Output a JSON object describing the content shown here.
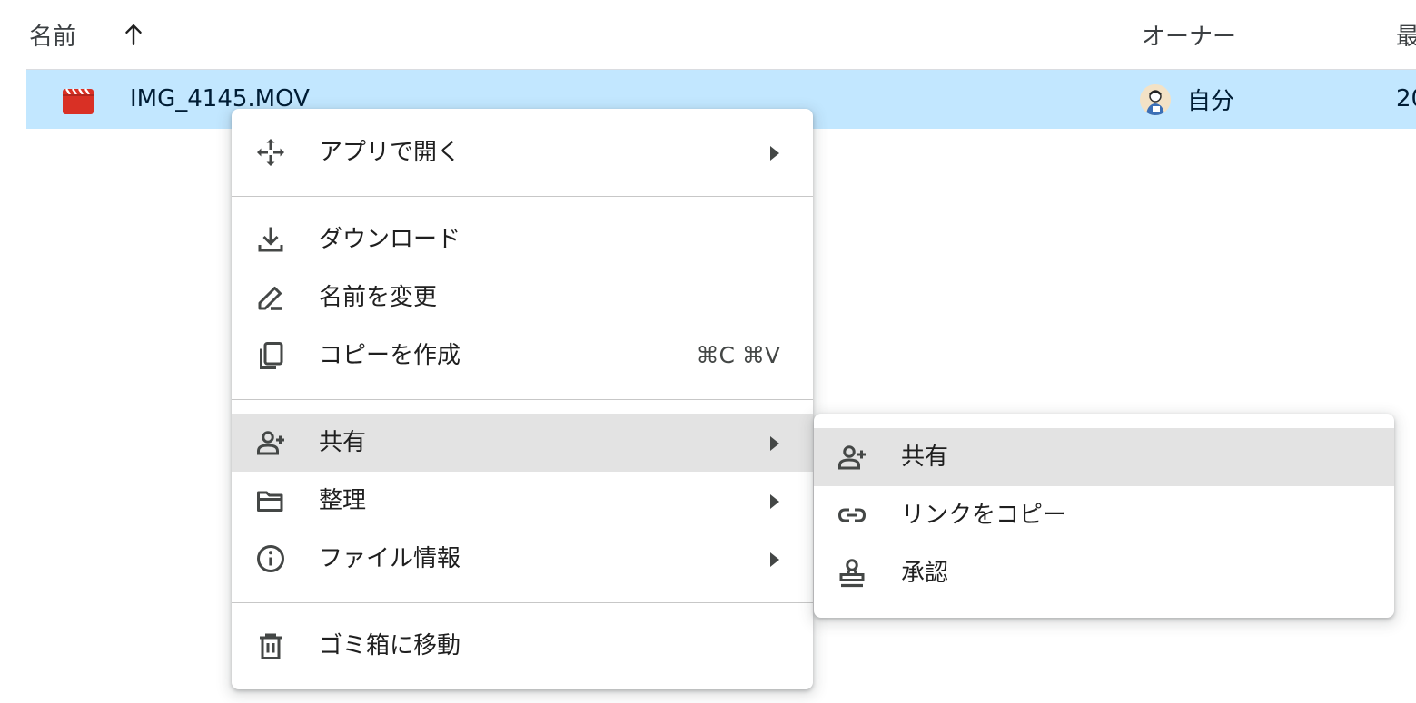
{
  "header": {
    "name_label": "名前",
    "sort_direction_icon": "arrow-up-icon",
    "owner_label": "オーナー",
    "modified_label": "最"
  },
  "file_row": {
    "icon": "video-file-icon",
    "icon_color": "#d93025",
    "name": "IMG_4145.MOV",
    "owner": "自分",
    "modified": "20",
    "selected_bg": "#c2e7ff"
  },
  "context_menu": {
    "items": [
      {
        "label": "アプリで開く",
        "icon": "open-with-icon",
        "submenu": true
      },
      {
        "label": "ダウンロード",
        "icon": "download-icon"
      },
      {
        "label": "名前を変更",
        "icon": "rename-icon"
      },
      {
        "label": "コピーを作成",
        "icon": "copy-icon",
        "shortcut": "⌘C ⌘V"
      },
      {
        "label": "共有",
        "icon": "person-add-icon",
        "submenu": true,
        "highlighted": true
      },
      {
        "label": "整理",
        "icon": "folder-icon",
        "submenu": true
      },
      {
        "label": "ファイル情報",
        "icon": "info-icon",
        "submenu": true
      },
      {
        "label": "ゴミ箱に移動",
        "icon": "trash-icon"
      }
    ]
  },
  "share_submenu": {
    "items": [
      {
        "label": "共有",
        "icon": "person-add-icon",
        "highlighted": true
      },
      {
        "label": "リンクをコピー",
        "icon": "link-icon"
      },
      {
        "label": "承認",
        "icon": "approval-stamp-icon"
      }
    ]
  }
}
